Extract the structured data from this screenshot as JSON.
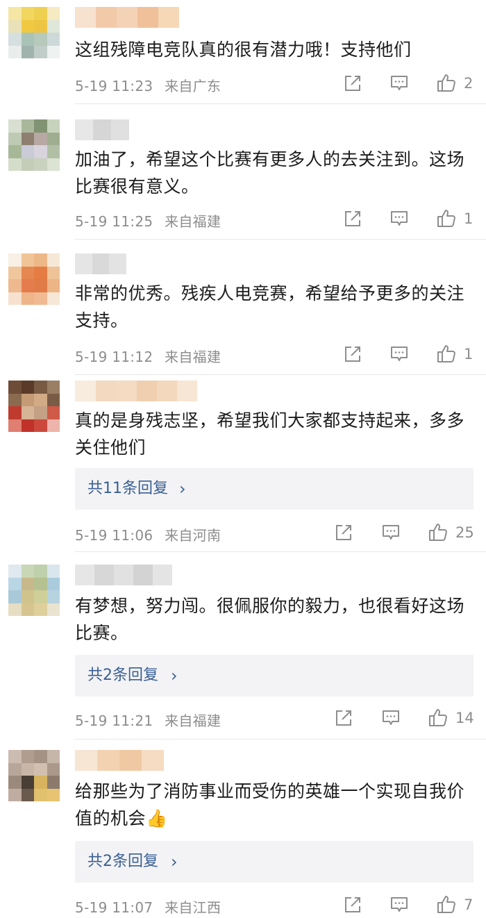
{
  "colors": {
    "text": "#1c1c1c",
    "meta": "#8d8d8d",
    "link": "#3a5f93",
    "replies_bg": "#f3f3f5",
    "divider": "#e7e7e7"
  },
  "comments": [
    {
      "text": "这组残障电竞队真的很有潜力哦！支持他们",
      "time": "5-19 11:23",
      "location": "来自广东",
      "likes": "2"
    },
    {
      "text": "加油了，希望这个比赛有更多人的去关注到。这场比赛很有意义。",
      "time": "5-19 11:25",
      "location": "来自福建",
      "likes": "1"
    },
    {
      "text": "非常的优秀。残疾人电竞赛，希望给予更多的关注支持。",
      "time": "5-19 11:12",
      "location": "来自福建",
      "likes": "1"
    },
    {
      "text": "真的是身残志坚，希望我们大家都支持起来，多多关住他们",
      "replies": "共11条回复",
      "time": "5-19 11:06",
      "location": "来自河南",
      "likes": "25"
    },
    {
      "text": "有梦想，努力闯。很佩服你的毅力，也很看好这场比赛。",
      "replies": "共2条回复",
      "time": "5-19 11:21",
      "location": "来自福建",
      "likes": "14"
    },
    {
      "text": "给那些为了消防事业而受伤的英雄一个实现自我价值的机会👍",
      "replies": "共2条回复",
      "time": "5-19 11:07",
      "location": "来自江西",
      "likes": "7"
    }
  ],
  "icons": {
    "share": "share-icon",
    "comment": "comment-icon",
    "like": "thumbs-up-icon",
    "chevron": "chevron-right-icon"
  }
}
